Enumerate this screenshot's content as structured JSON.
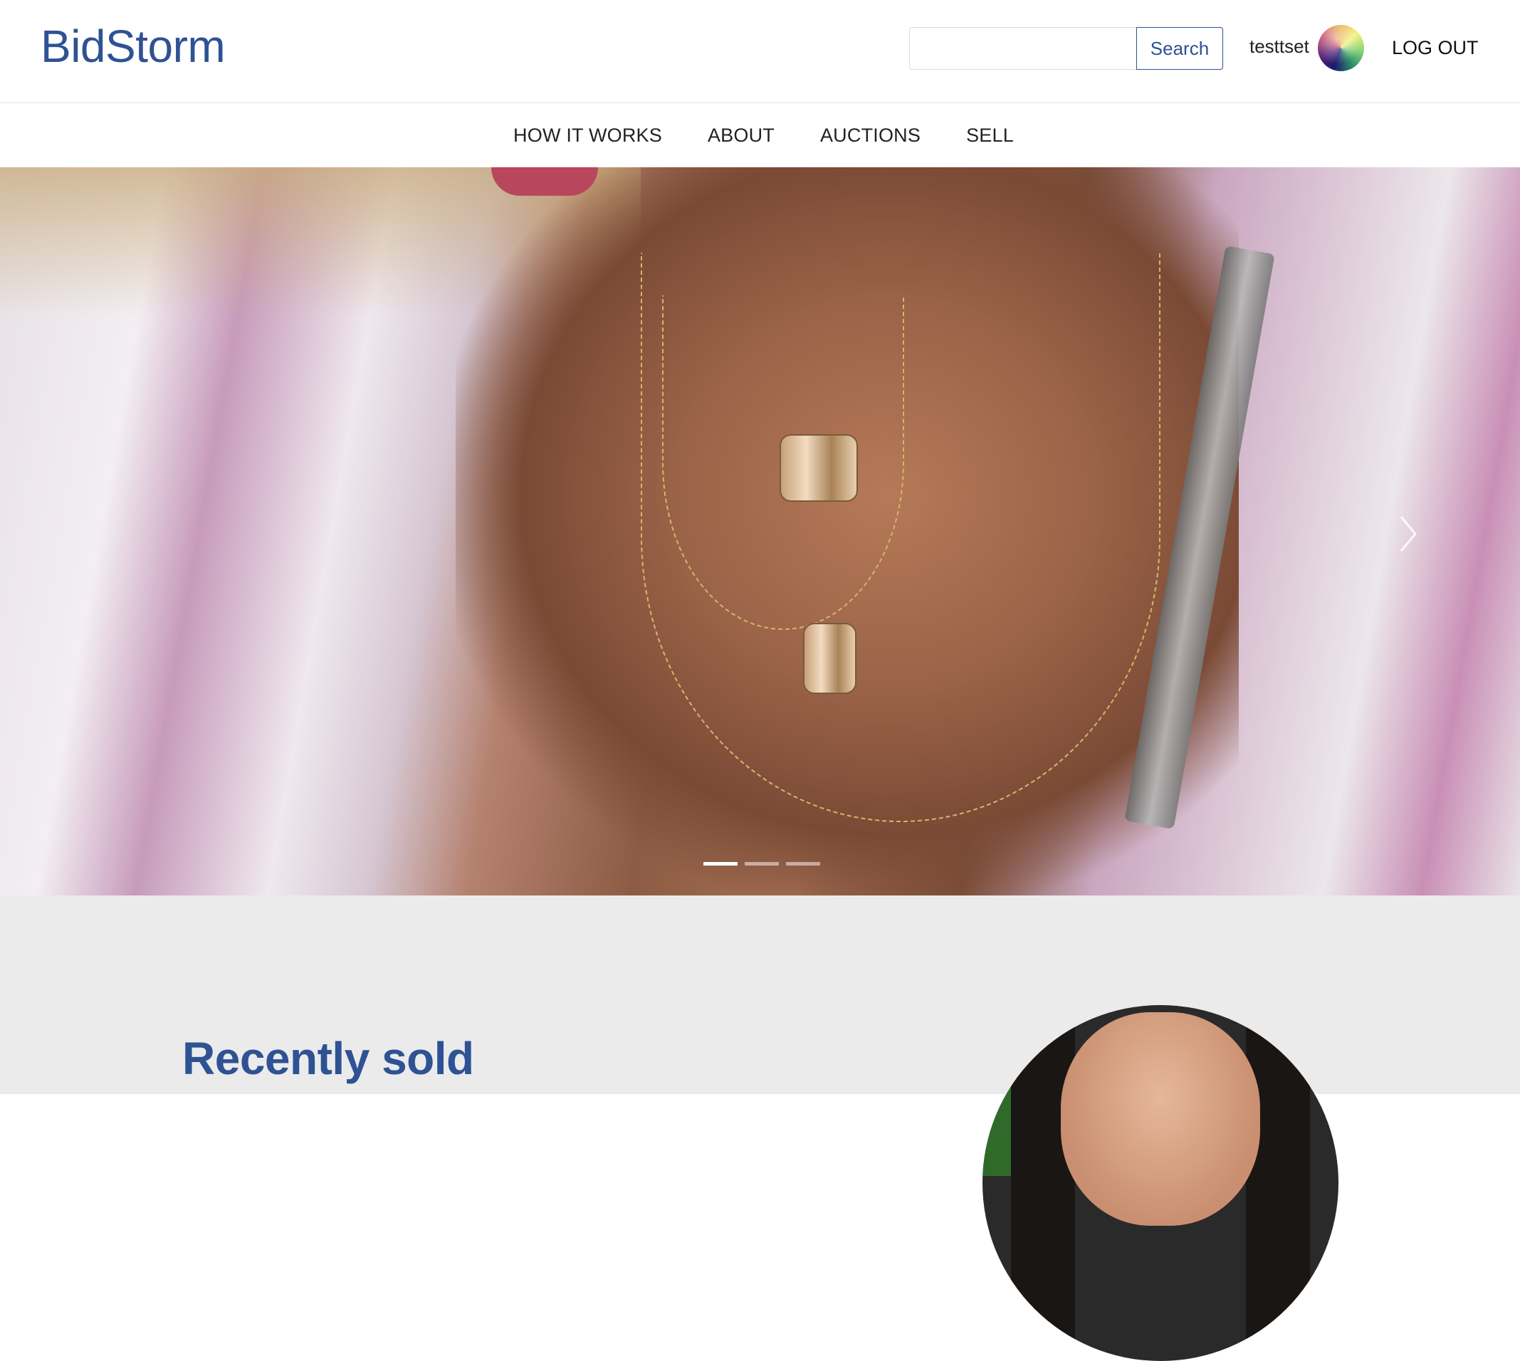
{
  "header": {
    "logo": "BidStorm",
    "search": {
      "placeholder": "",
      "value": "",
      "button_label": "Search"
    },
    "username": "testtset",
    "logout_label": "LOG OUT"
  },
  "nav": {
    "items": [
      {
        "label": "HOW IT WORKS"
      },
      {
        "label": "ABOUT"
      },
      {
        "label": "AUCTIONS"
      },
      {
        "label": "SELL"
      }
    ]
  },
  "carousel": {
    "slide_count": 3,
    "active_index": 0,
    "next_icon": "chevron-right-icon"
  },
  "recently_sold": {
    "title": "Recently sold"
  },
  "colors": {
    "brand": "#2e5293",
    "section_bg": "#ebebeb"
  }
}
